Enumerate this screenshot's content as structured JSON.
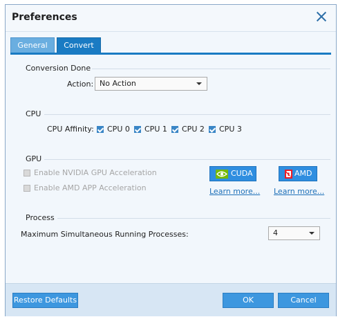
{
  "dialog": {
    "title": "Preferences"
  },
  "tabs": [
    {
      "label": "General"
    },
    {
      "label": "Convert"
    }
  ],
  "conversion_done": {
    "section_title": "Conversion Done",
    "action_label": "Action:",
    "action_value": "No Action"
  },
  "cpu": {
    "section_title": "CPU",
    "affinity_label": "CPU Affinity:",
    "cores": [
      {
        "label": "CPU 0",
        "checked": true
      },
      {
        "label": "CPU 1",
        "checked": true
      },
      {
        "label": "CPU 2",
        "checked": true
      },
      {
        "label": "CPU 3",
        "checked": true
      }
    ]
  },
  "gpu": {
    "section_title": "GPU",
    "nvidia_option": "Enable NVIDIA GPU Acceleration",
    "amd_option": "Enable AMD APP Acceleration",
    "cuda_label": "CUDA",
    "amd_label": "AMD",
    "learn_more_cuda": "Learn more...",
    "learn_more_amd": "Learn more..."
  },
  "process": {
    "section_title": "Process",
    "max_label": "Maximum Simultaneous Running Processes:",
    "max_value": "4"
  },
  "footer": {
    "restore_label": "Restore Defaults",
    "ok_label": "OK",
    "cancel_label": "Cancel"
  },
  "colors": {
    "accent": "#1a7bc3",
    "button": "#3d97df",
    "link": "#1c6fb8",
    "nvidia_green": "#76b900",
    "amd_red": "#ed1c24"
  }
}
